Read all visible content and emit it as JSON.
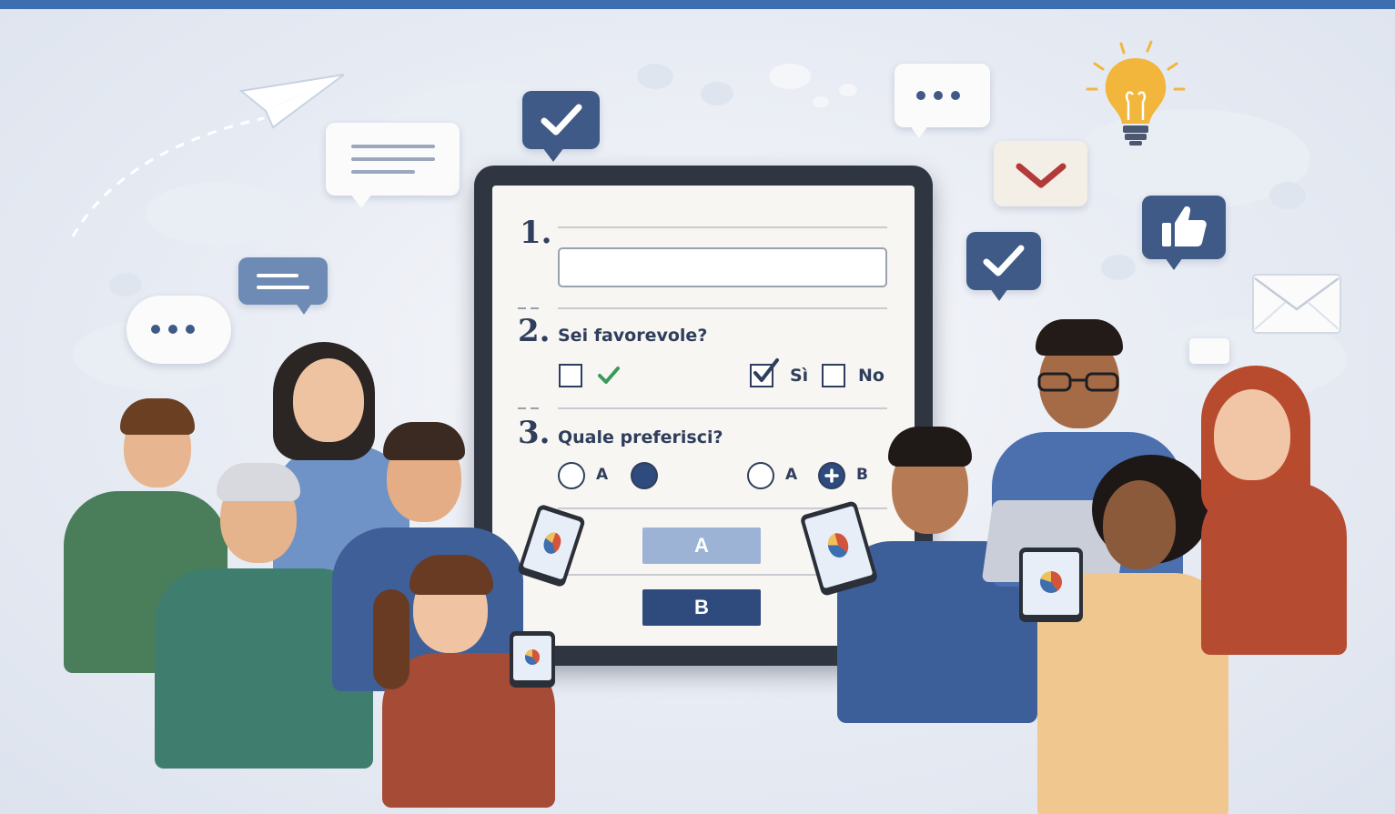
{
  "form": {
    "q1": {
      "number": "1."
    },
    "q2": {
      "number": "2.",
      "text": "Sei favorevole?",
      "options": [
        "Sì",
        "No"
      ]
    },
    "q3": {
      "number": "3.",
      "text": "Quale preferisci?",
      "options_left": [
        "A"
      ],
      "options_right": [
        "A",
        "B"
      ]
    },
    "buttons": {
      "a": "A",
      "b": "B"
    }
  },
  "colors": {
    "topbar": "#3d6fb0",
    "navy": "#2f4a7d",
    "light_blue_button": "#9db3d6",
    "check_green": "#3a9a5b",
    "chevron_red": "#b33a3a",
    "bulb_yellow": "#f2b63c"
  },
  "icons": [
    "paper-plane-icon",
    "checkmark-icon",
    "ellipsis-icon",
    "lightbulb-icon",
    "chevron-down-icon",
    "thumbs-up-icon",
    "envelope-icon"
  ]
}
